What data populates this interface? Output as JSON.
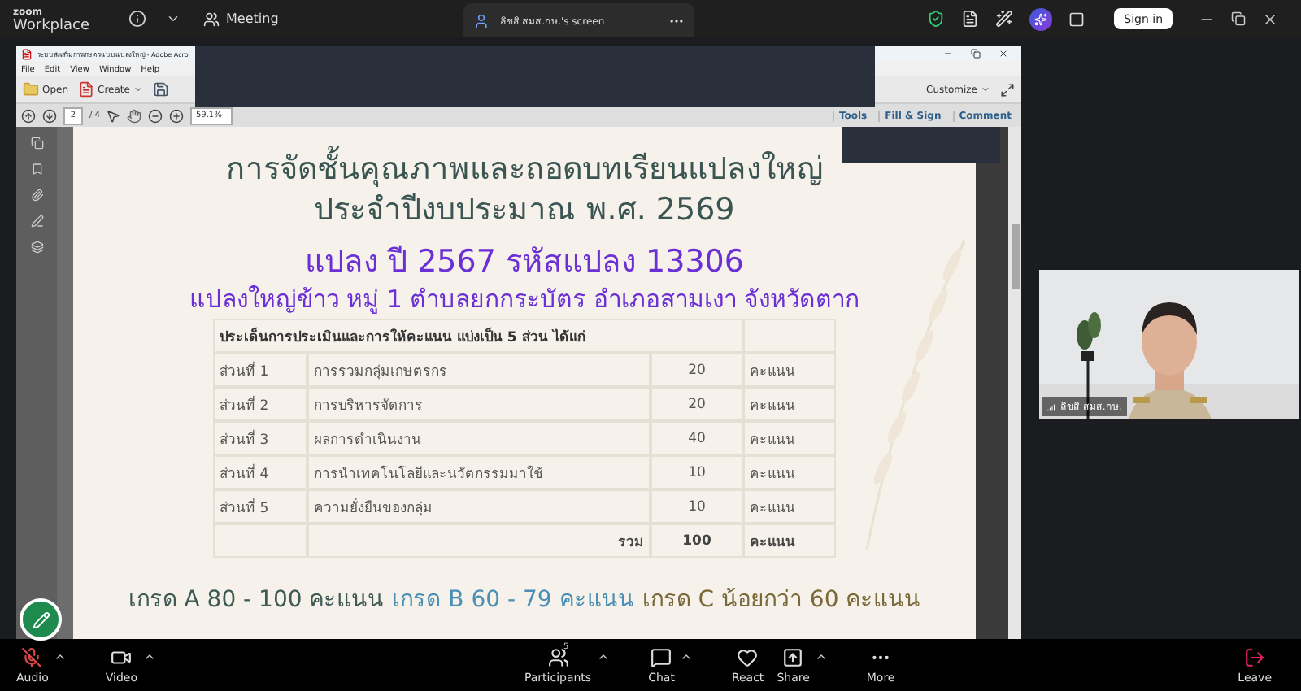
{
  "app": {
    "logo_top": "zoom",
    "logo_bottom": "Workplace",
    "meeting_label": "Meeting",
    "share_tab": "ลิขสิ สมส.กษ.'s screen",
    "sign_in": "Sign in"
  },
  "acrobat": {
    "title": "ระบบส่งเสริมการเกษตรแบบแปลงใหญ่ - Adobe Acro",
    "menu": [
      "File",
      "Edit",
      "View",
      "Window",
      "Help"
    ],
    "open": "Open",
    "create": "Create",
    "customize": "Customize",
    "page": "2",
    "page_total": "/ 4",
    "zoom": "59.1%",
    "panels": [
      "Tools",
      "Fill & Sign",
      "Comment"
    ]
  },
  "slide": {
    "title_1": "การจัดชั้นคุณภาพและถอดบทเรียนแปลงใหญ่",
    "title_2": "ประจำปีงบประมาณ พ.ศ. 2569",
    "plot": "แปลง ปี 2567 รหัสแปลง 13306",
    "place": "แปลงใหญ่ข้าว หมู่ 1 ตำบลยกกระบัตร อำเภอสามเงา จังหวัดตาก",
    "table_heading": "ประเด็นการประเมินและการให้คะแนน แบ่งเป็น 5 ส่วน ได้แก่",
    "rows": [
      {
        "part": "ส่วนที่ 1",
        "topic": "การรวมกลุ่มเกษตรกร",
        "score": "20",
        "unit": "คะแนน"
      },
      {
        "part": "ส่วนที่ 2",
        "topic": "การบริหารจัดการ",
        "score": "20",
        "unit": "คะแนน"
      },
      {
        "part": "ส่วนที่ 3",
        "topic": "ผลการดำเนินงาน",
        "score": "40",
        "unit": "คะแนน"
      },
      {
        "part": "ส่วนที่ 4",
        "topic": "การนำเทคโนโลยีและนวัตกรรมมาใช้",
        "score": "10",
        "unit": "คะแนน"
      },
      {
        "part": "ส่วนที่ 5",
        "topic": "ความยั่งยืนของกลุ่ม",
        "score": "10",
        "unit": "คะแนน"
      }
    ],
    "total": {
      "label": "รวม",
      "score": "100",
      "unit": "คะแนน"
    },
    "grades": [
      {
        "text": "เกรด A 80 - 100 คะแนน",
        "color": "#3d5a55"
      },
      {
        "text": "เกรด B 60 - 79 คะแนน",
        "color": "#4a8fb5"
      },
      {
        "text": "เกรด C น้อยกว่า 60 คะแนน",
        "color": "#7a6a3a"
      }
    ]
  },
  "video": {
    "name": "ลิขสิ สมส.กษ."
  },
  "toolbar": [
    {
      "label": "Audio",
      "kind": "audio",
      "caret": true
    },
    {
      "label": "Video",
      "kind": "video",
      "caret": true
    },
    {
      "label": "Participants",
      "kind": "participants",
      "count": "5",
      "caret": true
    },
    {
      "label": "Chat",
      "kind": "chat",
      "caret": true
    },
    {
      "label": "React",
      "kind": "react",
      "caret": false
    },
    {
      "label": "Share",
      "kind": "share",
      "caret": true
    },
    {
      "label": "More",
      "kind": "more",
      "caret": false
    },
    {
      "label": "Leave",
      "kind": "leave",
      "caret": false
    }
  ]
}
